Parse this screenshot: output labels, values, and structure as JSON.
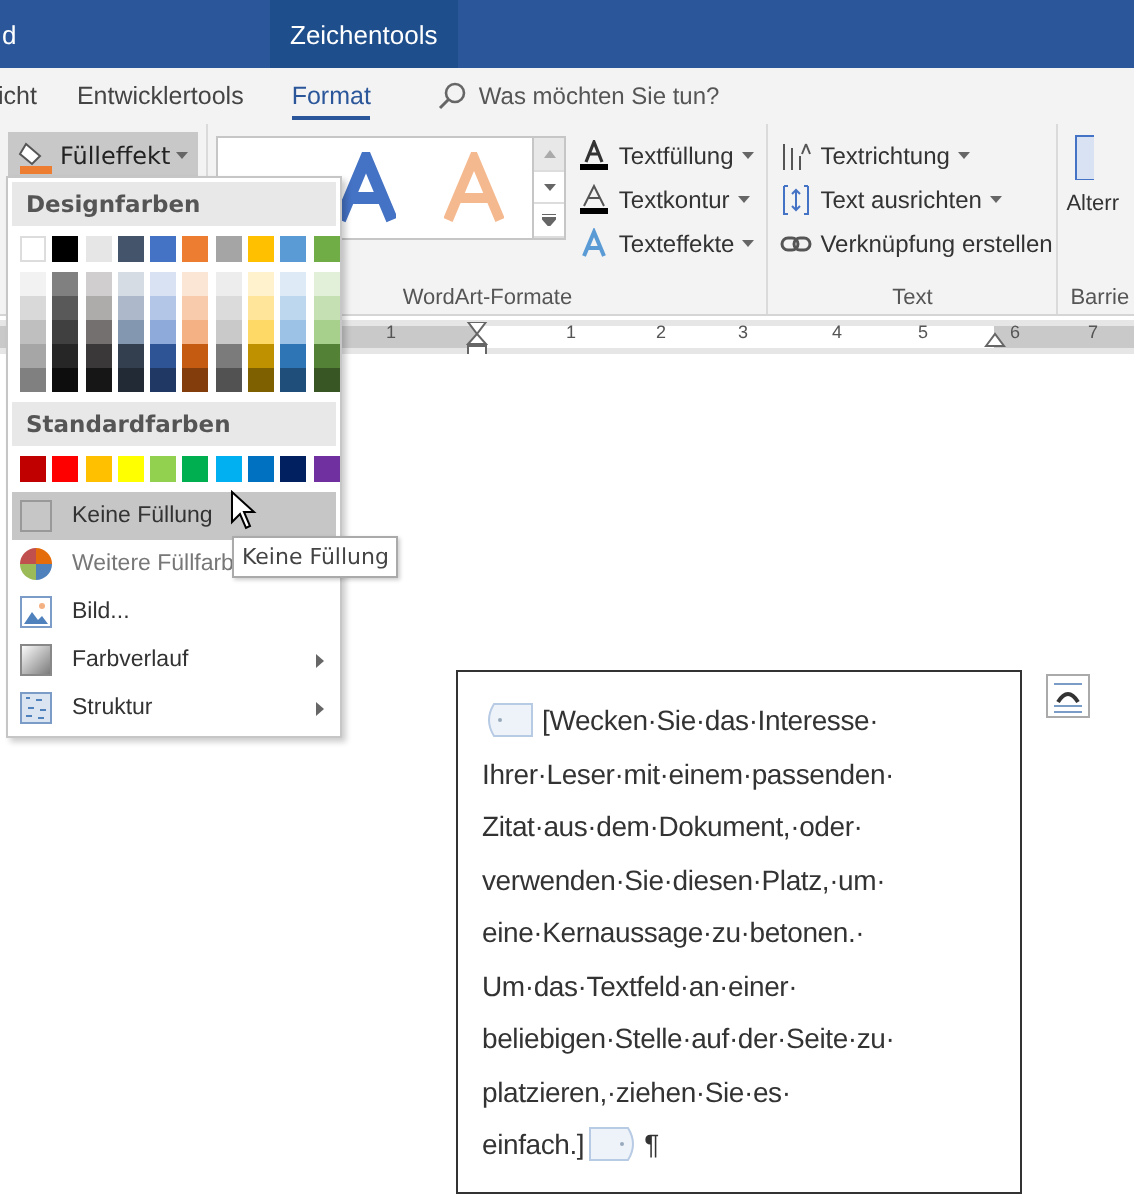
{
  "title_bar": {
    "title_fragment": "d",
    "context_tab": "Zeichentools"
  },
  "tabs": [
    {
      "label": "icht",
      "selected": false
    },
    {
      "label": "Entwicklertools",
      "selected": false
    },
    {
      "label": "Format",
      "selected": true
    }
  ],
  "search": {
    "placeholder": "Was möchten Sie tun?"
  },
  "ribbon": {
    "fill_button": "Fülleffekt",
    "wordart_group": "WordArt-Formate",
    "wordart_styles": [
      {
        "color": "#4472c4"
      },
      {
        "color": "#f4b183"
      }
    ],
    "text_commands": [
      {
        "label": "Textfüllung",
        "kind": "fill"
      },
      {
        "label": "Textkontur",
        "kind": "outline"
      },
      {
        "label": "Texteffekte",
        "kind": "effects"
      }
    ],
    "text_group": "Text",
    "text_group_commands": [
      {
        "label": "Textrichtung",
        "kind": "direction",
        "dropdown": true
      },
      {
        "label": "Text ausrichten",
        "kind": "align",
        "dropdown": true
      },
      {
        "label": "Verknüpfung erstellen",
        "kind": "link",
        "dropdown": false
      }
    ],
    "cut_button": "Alterr",
    "cut_group": "Barrie"
  },
  "ruler": [
    "1",
    "1",
    "2",
    "3",
    "4",
    "5",
    "6",
    "7"
  ],
  "menu": {
    "design_heading": "Designfarben",
    "design_colors": [
      {
        "color": "#ffffff",
        "shades": [
          {
            "color": "#f2f2f2"
          },
          {
            "color": "#d9d9d9"
          },
          {
            "color": "#bfbfbf"
          },
          {
            "color": "#a6a6a6"
          },
          {
            "color": "#808080"
          }
        ]
      },
      {
        "color": "#000000",
        "shades": [
          {
            "color": "#808080"
          },
          {
            "color": "#595959"
          },
          {
            "color": "#404040"
          },
          {
            "color": "#262626"
          },
          {
            "color": "#0d0d0d"
          }
        ]
      },
      {
        "color": "#e7e6e6",
        "shades": [
          {
            "color": "#d0cece"
          },
          {
            "color": "#aeabab"
          },
          {
            "color": "#757070"
          },
          {
            "color": "#3a3838"
          },
          {
            "color": "#171616"
          }
        ]
      },
      {
        "color": "#44546a",
        "shades": [
          {
            "color": "#d6dce4"
          },
          {
            "color": "#adb9ca"
          },
          {
            "color": "#8497b0"
          },
          {
            "color": "#333f4f"
          },
          {
            "color": "#222a35"
          }
        ]
      },
      {
        "color": "#4472c4",
        "shades": [
          {
            "color": "#d9e2f3"
          },
          {
            "color": "#b4c6e7"
          },
          {
            "color": "#8eaadb"
          },
          {
            "color": "#2f5496"
          },
          {
            "color": "#1f3864"
          }
        ]
      },
      {
        "color": "#ed7d31",
        "shades": [
          {
            "color": "#fbe5d5"
          },
          {
            "color": "#f7cbac"
          },
          {
            "color": "#f4b183"
          },
          {
            "color": "#c55a11"
          },
          {
            "color": "#833c0b"
          }
        ]
      },
      {
        "color": "#a5a5a5",
        "shades": [
          {
            "color": "#ededed"
          },
          {
            "color": "#dbdbdb"
          },
          {
            "color": "#c9c9c9"
          },
          {
            "color": "#7b7b7b"
          },
          {
            "color": "#525252"
          }
        ]
      },
      {
        "color": "#ffc000",
        "shades": [
          {
            "color": "#fff2cc"
          },
          {
            "color": "#fee599"
          },
          {
            "color": "#ffd965"
          },
          {
            "color": "#bf9000"
          },
          {
            "color": "#7f6000"
          }
        ]
      },
      {
        "color": "#5b9bd5",
        "shades": [
          {
            "color": "#deebf6"
          },
          {
            "color": "#bdd7ee"
          },
          {
            "color": "#9cc3e5"
          },
          {
            "color": "#2e75b5"
          },
          {
            "color": "#1e4e79"
          }
        ]
      },
      {
        "color": "#70ad47",
        "shades": [
          {
            "color": "#e2efd9"
          },
          {
            "color": "#c5e0b3"
          },
          {
            "color": "#a8d08d"
          },
          {
            "color": "#538135"
          },
          {
            "color": "#375623"
          }
        ]
      }
    ],
    "standard_heading": "Standardfarben",
    "standard_colors": [
      {
        "color": "#c00000"
      },
      {
        "color": "#ff0000"
      },
      {
        "color": "#ffc000"
      },
      {
        "color": "#ffff00"
      },
      {
        "color": "#92d050"
      },
      {
        "color": "#00b050"
      },
      {
        "color": "#00b0f0"
      },
      {
        "color": "#0070c0"
      },
      {
        "color": "#002060"
      },
      {
        "color": "#7030a0"
      }
    ],
    "items": [
      {
        "label": "Keine Füllung",
        "kind": "none",
        "selected": true,
        "submenu": false
      },
      {
        "label": "Weitere Füllfarb",
        "kind": "more",
        "selected": false,
        "submenu": false
      },
      {
        "label": "Bild...",
        "kind": "picture",
        "selected": false,
        "submenu": false
      },
      {
        "label": "Farbverlauf",
        "kind": "gradient",
        "selected": false,
        "submenu": true
      },
      {
        "label": "Struktur",
        "kind": "texture",
        "selected": false,
        "submenu": true
      }
    ]
  },
  "tooltip": "Keine Füllung",
  "text_box": {
    "lines": [
      "[Wecken·Sie·das·Interesse·",
      "Ihrer·Leser·mit·einem·passenden·",
      "Zitat·aus·dem·Dokument,·oder·",
      "verwenden·Sie·diesen·Platz,·um·",
      "eine·Kernaussage·zu·betonen.·",
      "Um·das·Textfeld·an·einer·",
      "beliebigen·Stelle·auf·der·Seite·zu·",
      "platzieren,·ziehen·Sie·es·",
      "einfach.]"
    ],
    "end_mark": "¶"
  }
}
